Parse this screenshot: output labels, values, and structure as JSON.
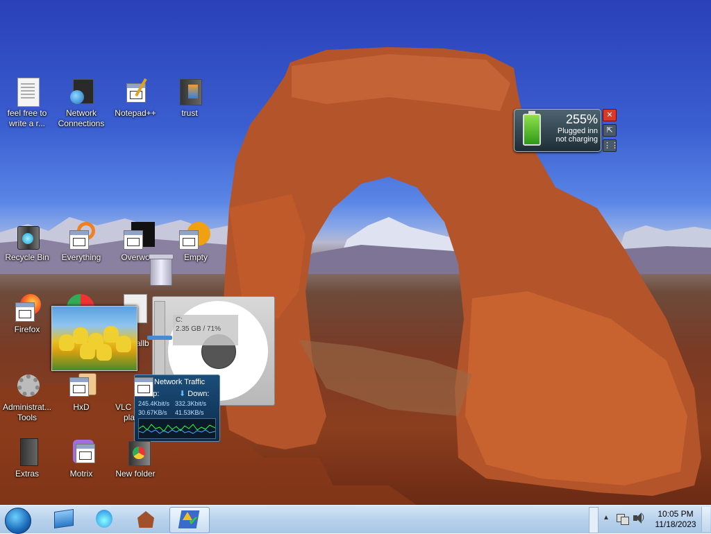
{
  "desktop": {
    "icons": [
      {
        "id": "feel-free",
        "label": "feel free to write a r..."
      },
      {
        "id": "network-connections",
        "label": "Network Connections"
      },
      {
        "id": "notepadpp",
        "label": "Notepad++"
      },
      {
        "id": "trust",
        "label": "trust"
      },
      {
        "id": "recycle-bin",
        "label": "Recycle Bin"
      },
      {
        "id": "everything",
        "label": "Everything"
      },
      {
        "id": "overwolf",
        "label": "Overwo"
      },
      {
        "id": "empty",
        "label": "Empty"
      },
      {
        "id": "firefox",
        "label": "Firefox"
      },
      {
        "id": "wallpaper",
        "label": "allb"
      },
      {
        "id": "administrative-tools",
        "label": "Administrat... Tools"
      },
      {
        "id": "hxd",
        "label": "HxD"
      },
      {
        "id": "vlc",
        "label": "VLC"
      },
      {
        "id": "vlc-line2",
        "label": "pla"
      },
      {
        "id": "extras",
        "label": "Extras"
      },
      {
        "id": "motrix",
        "label": "Motrix"
      },
      {
        "id": "new-folder",
        "label": "New folder"
      }
    ]
  },
  "battery_gadget": {
    "percent": "255%",
    "status_line1": "Plugged inn",
    "status_line2": "not charging"
  },
  "drive_gadget": {
    "label": "C:",
    "usage": "2.35 GB / 71%"
  },
  "network_gadget": {
    "title": "Network Traffic",
    "up_label": "Up:",
    "down_label": "Down:",
    "up_kbits": "245.4Kbit/s",
    "down_kbits": "332.3Kbit/s",
    "up_kbytes": "30.67KB/s",
    "down_kbytes": "41.53KB/s"
  },
  "taskbar": {
    "time": "10:05 PM",
    "date": "11/18/2023",
    "buttons": [
      "explorer",
      "gadgets",
      "birdhouse",
      "action-center"
    ]
  }
}
